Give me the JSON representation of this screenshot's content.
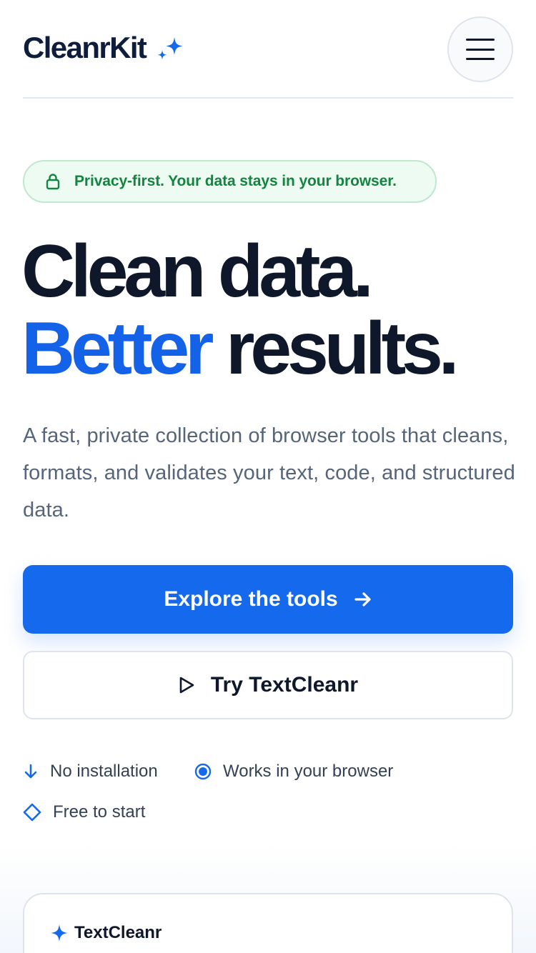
{
  "header": {
    "logo_text": "CleanrKit",
    "logo_icon": "sparkle-icon",
    "menu_icon": "hamburger-menu-icon"
  },
  "privacy_badge": {
    "icon": "lock-icon",
    "text": "Privacy-first. Your data stays in your browser."
  },
  "hero": {
    "title_line1": "Clean data.",
    "title_line2_accent": "Better",
    "title_line2_rest": "results.",
    "description": "A fast, private collection of browser tools that cleans, formats, and validates your text, code, and structured data."
  },
  "actions": {
    "primary_label": "Explore the tools",
    "primary_icon": "arrow-right-icon",
    "secondary_label": "Try TextCleanr",
    "secondary_icon": "play-icon"
  },
  "features": [
    {
      "icon": "arrow-down-icon",
      "label": "No installation"
    },
    {
      "icon": "radio-dot-icon",
      "label": "Works in your browser"
    },
    {
      "icon": "diamond-icon",
      "label": "Free to start"
    }
  ],
  "preview_card": {
    "icon": "sparkle-icon",
    "title": "TextCleanr"
  },
  "colors": {
    "accent": "#1569ec",
    "text_dark": "#0f172a",
    "success_green": "#12853f",
    "success_bg": "#eefbf3",
    "muted_text": "#56657a"
  }
}
